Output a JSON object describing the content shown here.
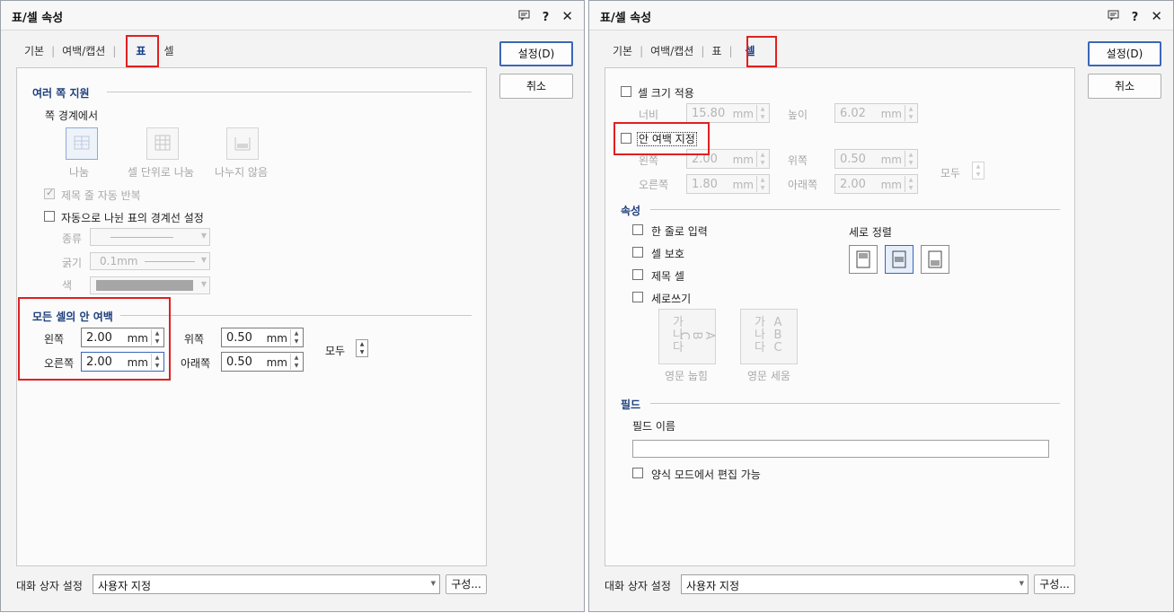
{
  "dialog_left": {
    "title": "표/셀 속성",
    "title_icons": [
      "comment-icon",
      "help-icon",
      "close-icon"
    ],
    "tabs": [
      {
        "label": "기본"
      },
      {
        "label": "여백/캡션"
      },
      {
        "label": "표",
        "active": true
      },
      {
        "label": "셀"
      }
    ],
    "buttons": {
      "ok": "설정(D)",
      "cancel": "취소",
      "configure": "구성..."
    },
    "page_split": {
      "group_title": "여러 쪽 지원",
      "sub_label": "쪽 경계에서",
      "options": [
        "나눔",
        "셀 단위로 나눔",
        "나누지 않음"
      ],
      "repeat_header_label": "제목 줄 자동 반복",
      "repeat_header_checked": true,
      "auto_border_label": "자동으로 나뉜 표의 경계선 설정",
      "auto_border_checked": false,
      "type_label": "종류",
      "thickness_label": "굵기",
      "thickness_value": "0.1mm",
      "color_label": "색"
    },
    "cell_margin": {
      "group_title": "모든 셀의 안 여백",
      "left_label": "왼쪽",
      "left_value": "2.00",
      "right_label": "오른쪽",
      "right_value": "2.00",
      "top_label": "위쪽",
      "top_value": "0.50",
      "bottom_label": "아래쪽",
      "bottom_value": "0.50",
      "all_label": "모두",
      "unit": "mm"
    },
    "footer": {
      "label": "대화 상자 설정",
      "value": "사용자 지정"
    }
  },
  "dialog_right": {
    "title": "표/셀 속성",
    "title_icons": [
      "comment-icon",
      "help-icon",
      "close-icon"
    ],
    "tabs": [
      {
        "label": "기본"
      },
      {
        "label": "여백/캡션"
      },
      {
        "label": "표"
      },
      {
        "label": "셀",
        "active": true
      }
    ],
    "buttons": {
      "ok": "설정(D)",
      "cancel": "취소",
      "configure": "구성..."
    },
    "cell_size": {
      "apply_label": "셀 크기 적용",
      "apply_checked": false,
      "width_label": "너비",
      "width_value": "15.80",
      "height_label": "높이",
      "height_value": "6.02",
      "unit": "mm"
    },
    "inner_margin": {
      "apply_label": "안 여백 지정",
      "apply_checked": false,
      "left_label": "왼쪽",
      "left_value": "2.00",
      "right_label": "오른쪽",
      "right_value": "1.80",
      "top_label": "위쪽",
      "top_value": "0.50",
      "bottom_label": "아래쪽",
      "bottom_value": "2.00",
      "all_label": "모두",
      "unit": "mm"
    },
    "properties": {
      "group_title": "속성",
      "single_line_label": "한 줄로 입력",
      "protect_label": "셀 보호",
      "header_cell_label": "제목 셀",
      "vertical_write_label": "세로쓰기",
      "vertical_align_label": "세로 정렬",
      "vertical_align_selected": "middle",
      "vt_lying": "영문 눕힘",
      "vt_upright": "영문 세움",
      "vt_korean": [
        "가",
        "나",
        "다"
      ],
      "vt_latin": [
        "A",
        "B",
        "C"
      ]
    },
    "field": {
      "group_title": "필드",
      "name_label": "필드 이름",
      "name_value": "",
      "edit_in_form_label": "양식 모드에서 편집 가능",
      "edit_in_form_checked": false
    },
    "footer": {
      "label": "대화 상자 설정",
      "value": "사용자 지정"
    }
  },
  "colors": {
    "highlight": "#e02020",
    "accent": "#1d3f7c",
    "default_button_border": "#3a67b8"
  }
}
